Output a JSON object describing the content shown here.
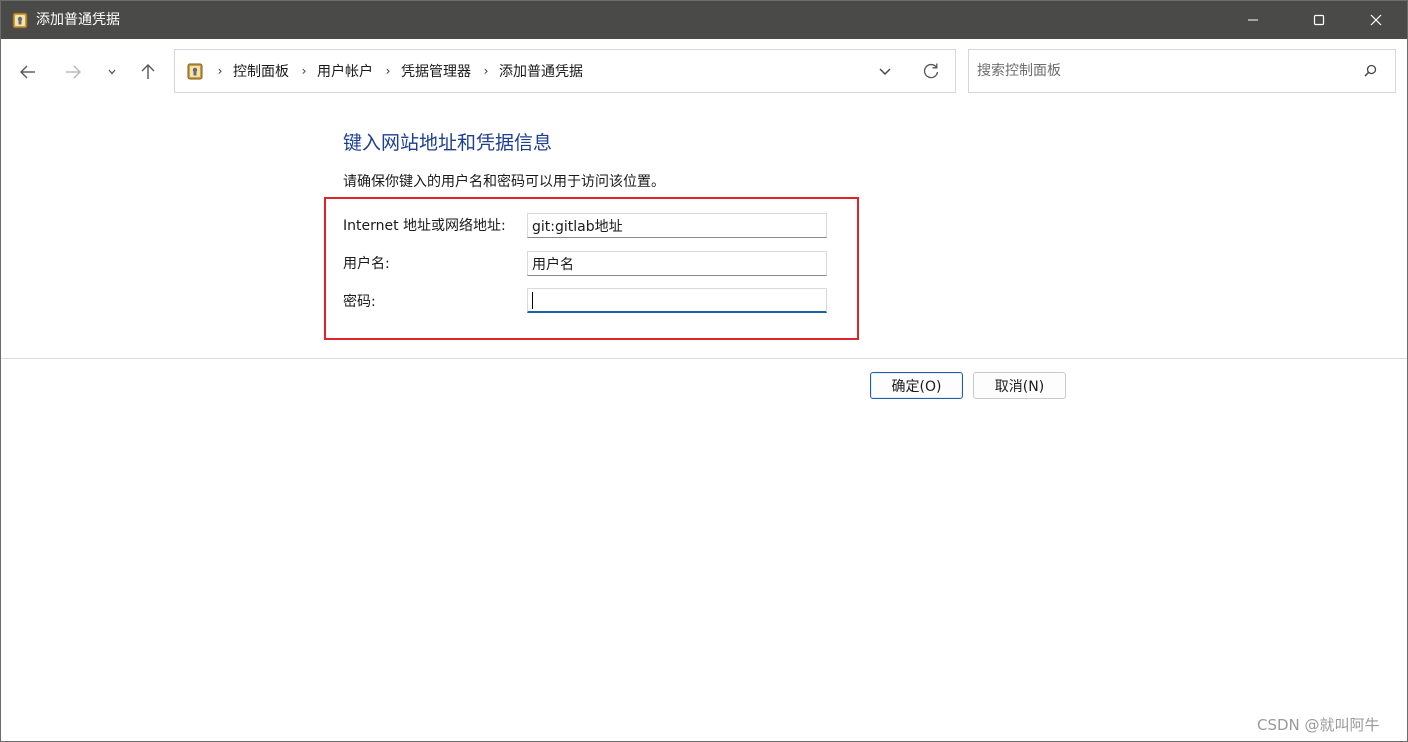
{
  "window": {
    "title": "添加普通凭据",
    "icon": "credential-manager-icon"
  },
  "nav": {
    "back_icon": "arrow-left-icon",
    "forward_icon": "arrow-right-icon",
    "recent_icon": "chevron-down-icon",
    "up_icon": "arrow-up-icon"
  },
  "address": {
    "breadcrumbs": [
      "控制面板",
      "用户帐户",
      "凭据管理器",
      "添加普通凭据"
    ],
    "separator": "›"
  },
  "search": {
    "placeholder": "搜索控制面板"
  },
  "content": {
    "title": "键入网站地址和凭据信息",
    "description": "请确保你键入的用户名和密码可以用于访问该位置。",
    "fields": [
      {
        "label": "Internet 地址或网络地址:",
        "value": "git:gitlab地址"
      },
      {
        "label": "用户名:",
        "value": "用户名"
      },
      {
        "label": "密码:",
        "value": ""
      }
    ]
  },
  "buttons": {
    "ok": "确定(O)",
    "cancel": "取消(N)"
  },
  "watermark": "CSDN @就叫阿牛",
  "colors": {
    "titlebar": "#4a4a48",
    "heading": "#1e3f8f",
    "highlight": "#e0242a",
    "focus": "#1f5fa8"
  }
}
